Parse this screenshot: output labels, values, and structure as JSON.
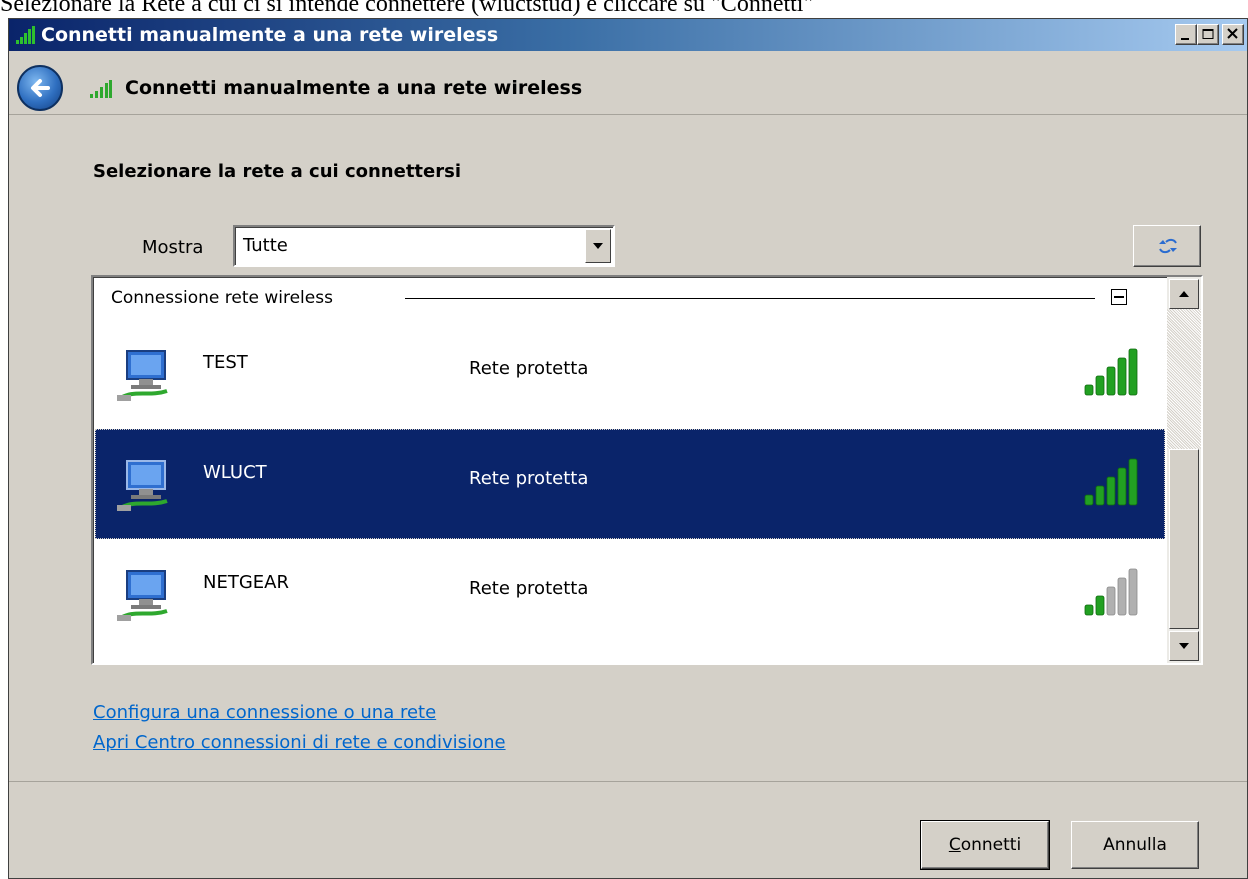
{
  "caption": "Selezionare la Rete a cui ci si intende connettere (wluctstud) e cliccare su \"Connetti\"",
  "window": {
    "title": "Connetti manualmente a una rete wireless",
    "header_title": "Connetti manualmente a una rete wireless"
  },
  "main": {
    "section_title": "Selezionare la rete a cui connettersi",
    "show_label": "Mostra",
    "show_value": "Tutte"
  },
  "network_list": {
    "group_label": "Connessione rete wireless",
    "networks": [
      {
        "name": "TEST",
        "status": "Rete protetta",
        "signal_bars": 5,
        "selected": false
      },
      {
        "name": "WLUCT",
        "status": "Rete protetta",
        "signal_bars": 5,
        "selected": true
      },
      {
        "name": "NETGEAR",
        "status": "Rete protetta",
        "signal_bars": 2,
        "selected": false
      }
    ]
  },
  "links": {
    "setup": "Configura una connessione o una rete",
    "network_center": "Apri Centro connessioni di rete e condivisione"
  },
  "buttons": {
    "connect_accel": "C",
    "connect_rest": "onnetti",
    "cancel": "Annulla"
  },
  "colors": {
    "selection": "#0a246a",
    "signal_active": "#22a022",
    "signal_inactive": "#b0b0b0",
    "link": "#0066cc"
  },
  "icons": {
    "title": "wifi-signal-icon",
    "back": "back-arrow-icon",
    "refresh": "refresh-icon",
    "network": "network-computer-icon",
    "signal": "signal-strength-icon"
  }
}
